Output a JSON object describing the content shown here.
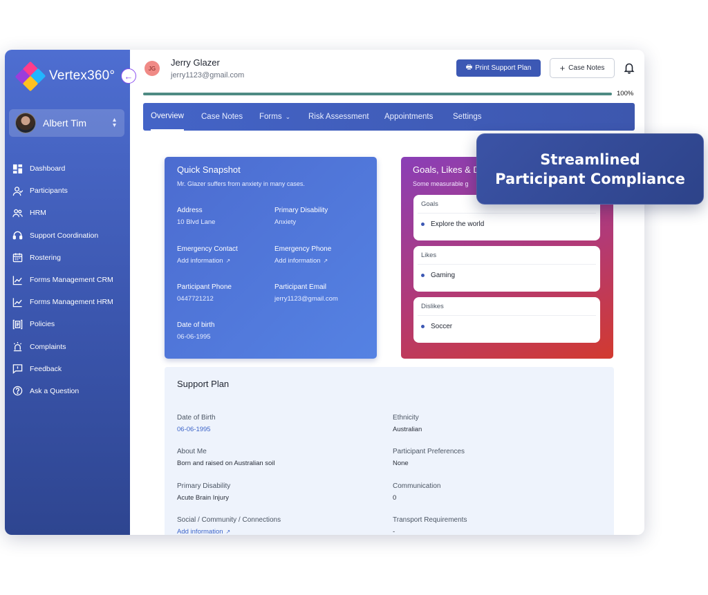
{
  "app": {
    "name": "Vertex360°"
  },
  "user": {
    "name": "Albert Tim"
  },
  "sidebar": {
    "items": [
      {
        "label": "Dashboard",
        "icon": "dashboard-icon"
      },
      {
        "label": "Participants",
        "icon": "participants-icon"
      },
      {
        "label": "HRM",
        "icon": "hrm-icon"
      },
      {
        "label": "Support Coordination",
        "icon": "headset-icon"
      },
      {
        "label": "Rostering",
        "icon": "calendar-icon"
      },
      {
        "label": "Forms Management CRM",
        "icon": "chart-icon"
      },
      {
        "label": "Forms Management HRM",
        "icon": "chart-icon"
      },
      {
        "label": "Policies",
        "icon": "policy-icon"
      },
      {
        "label": "Complaints",
        "icon": "alarm-icon"
      },
      {
        "label": "Feedback",
        "icon": "feedback-icon"
      },
      {
        "label": "Ask a Question",
        "icon": "help-icon"
      }
    ]
  },
  "header": {
    "initials": "JG",
    "participant_name": "Jerry Glazer",
    "participant_email": "jerry1123@gmail.com",
    "print_label": "Print Support Plan",
    "case_notes_label": "Case Notes",
    "progress_percent": 100,
    "progress_label": "100%"
  },
  "tabs": [
    "Overview",
    "Case Notes",
    "Forms",
    "Risk Assessment",
    "Appointments",
    "Settings"
  ],
  "snapshot": {
    "title": "Quick Snapshot",
    "description": "Mr. Glazer suffers from anxiety in many cases.",
    "address_label": "Address",
    "address": "10 Blvd Lane",
    "disability_label": "Primary Disability",
    "disability": "Anxiety",
    "emergency_contact_label": "Emergency Contact",
    "emergency_contact": "Add information",
    "emergency_phone_label": "Emergency Phone",
    "emergency_phone": "Add information",
    "phone_label": "Participant Phone",
    "phone": "0447721212",
    "email_label": "Participant Email",
    "email": "jerry1123@gmail.com",
    "dob_label": "Date of birth",
    "dob": "06-06-1995"
  },
  "goals": {
    "title": "Goals, Likes & D",
    "description": "Some measurable g",
    "cards": [
      {
        "heading": "Goals",
        "item": "Explore the world"
      },
      {
        "heading": "Likes",
        "item": "Gaming"
      },
      {
        "heading": "Dislikes",
        "item": "Soccer"
      }
    ]
  },
  "plan": {
    "title": "Support Plan",
    "dob_label": "Date of Birth",
    "dob": "06-06-1995",
    "ethnicity_label": "Ethnicity",
    "ethnicity": "Australian",
    "about_label": "About Me",
    "about": "Born and raised on Australian soil",
    "prefs_label": "Participant Preferences",
    "prefs": "None",
    "disability_label": "Primary Disability",
    "disability": "Acute Brain Injury",
    "comm_label": "Communication",
    "comm": "0",
    "social_label": "Social / Community / Connections",
    "social": "Add information",
    "transport_label": "Transport Requirements",
    "transport": "-"
  },
  "badge": {
    "line1": "Streamlined",
    "line2": "Participant Compliance"
  }
}
